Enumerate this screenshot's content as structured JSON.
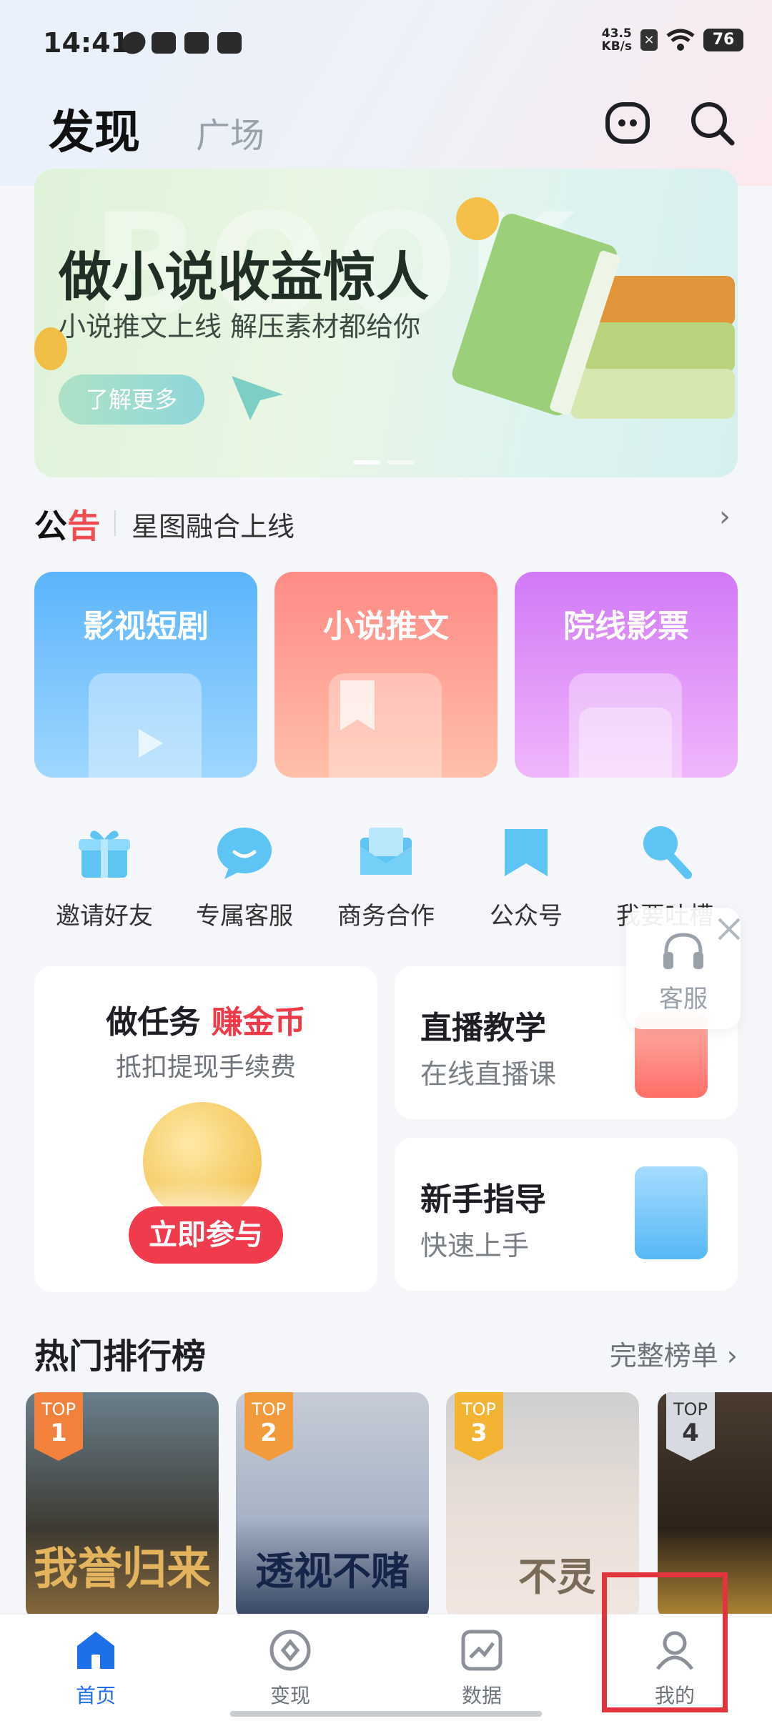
{
  "status_bar": {
    "time": "14:41",
    "net_speed": "43.5",
    "net_unit": "KB/s",
    "battery": "76"
  },
  "header": {
    "tab_active": "发现",
    "tab_inactive": "广场"
  },
  "banner": {
    "watermark": "BOOK",
    "title": "做小说收益惊人",
    "subtitle": "小说推文上线 解压素材都给你",
    "button": "了解更多"
  },
  "notice": {
    "label_a": "公",
    "label_b": "告",
    "text": "星图融合上线"
  },
  "categories": [
    {
      "label": "影视短剧",
      "color_from": "#5bb4fb",
      "color_to": "#9fd7ff"
    },
    {
      "label": "小说推文",
      "color_from": "#ff8a86",
      "color_to": "#ffc0a9"
    },
    {
      "label": "院线影票",
      "color_from": "#d179f6",
      "color_to": "#f0b6fb"
    }
  ],
  "quick_actions": [
    {
      "label": "邀请好友",
      "icon": "gift-icon"
    },
    {
      "label": "专属客服",
      "icon": "chat-bubble-icon"
    },
    {
      "label": "商务合作",
      "icon": "envelope-icon"
    },
    {
      "label": "公众号",
      "icon": "bookmark-icon"
    },
    {
      "label": "我要吐槽",
      "icon": "microphone-icon"
    }
  ],
  "float_service": {
    "label": "客服"
  },
  "task_card": {
    "title": "做任务",
    "title_highlight": "赚金币",
    "subtitle": "抵扣提现手续费",
    "button": "立即参与"
  },
  "side_cards": [
    {
      "title": "直播教学",
      "subtitle": "在线直播课"
    },
    {
      "title": "新手指导",
      "subtitle": "快速上手"
    }
  ],
  "ranking": {
    "title": "热门排行榜",
    "more": "完整榜单",
    "items": [
      {
        "badge": "TOP",
        "rank": "1",
        "poster_text": "我誉归来",
        "badge_color": "#f2813c"
      },
      {
        "badge": "TOP",
        "rank": "2",
        "poster_text": "透视不赌",
        "badge_color": "#f29a3c"
      },
      {
        "badge": "TOP",
        "rank": "3",
        "poster_text": "不灵",
        "badge_color": "#f3b433"
      },
      {
        "badge": "TOP",
        "rank": "4",
        "poster_text": "",
        "badge_color": "#d7dbe1"
      }
    ]
  },
  "bottom_nav": [
    {
      "label": "首页",
      "icon": "home-icon"
    },
    {
      "label": "变现",
      "icon": "monetize-icon"
    },
    {
      "label": "数据",
      "icon": "chart-icon"
    },
    {
      "label": "我的",
      "icon": "profile-icon"
    }
  ],
  "colors": {
    "accent": "#1d6fe8",
    "red": "#ef3b47",
    "highlight_box": "#e3333d"
  }
}
